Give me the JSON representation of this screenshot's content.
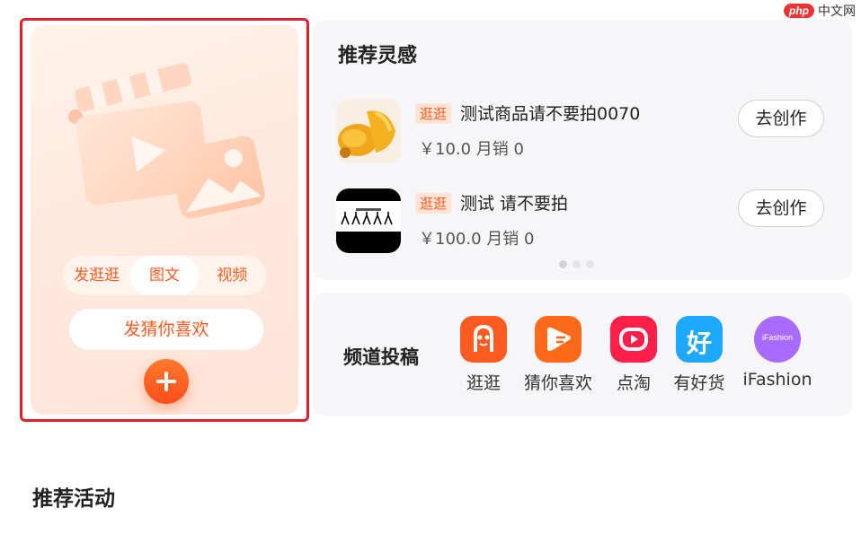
{
  "watermark": {
    "logo": "php",
    "text": "中文网"
  },
  "creation": {
    "tabs": [
      {
        "label": "发逛逛",
        "active": false
      },
      {
        "label": "图文",
        "active": true
      },
      {
        "label": "视频",
        "active": false
      }
    ],
    "guess_button": "发猜你喜欢",
    "plus_icon": "plus-icon"
  },
  "recommend": {
    "title": "推荐灵感",
    "products": [
      {
        "tag": "逛逛",
        "name": "测试商品请不要拍0070",
        "price": "￥10.0 月销 0",
        "button": "去创作"
      },
      {
        "tag": "逛逛",
        "name": "测试 请不要拍",
        "price": "￥100.0 月销 0",
        "button": "去创作"
      }
    ],
    "dots": 3
  },
  "channels": {
    "title": "频道投稿",
    "items": [
      {
        "label": "逛逛",
        "icon": "guangguang-icon",
        "color": "#ff5a1f"
      },
      {
        "label": "猜你喜欢",
        "icon": "guess-like-icon",
        "color": "#ff6a1a"
      },
      {
        "label": "点淘",
        "icon": "diantao-icon",
        "color": "#ff1f48"
      },
      {
        "label": "有好货",
        "icon": "youhaohuo-icon",
        "color": "#1fa8ff",
        "glyph": "好"
      },
      {
        "label": "iFashion",
        "icon": "ifashion-icon",
        "color": "#a96bff",
        "glyph": "iFashion"
      }
    ]
  },
  "activities": {
    "title": "推荐活动"
  }
}
